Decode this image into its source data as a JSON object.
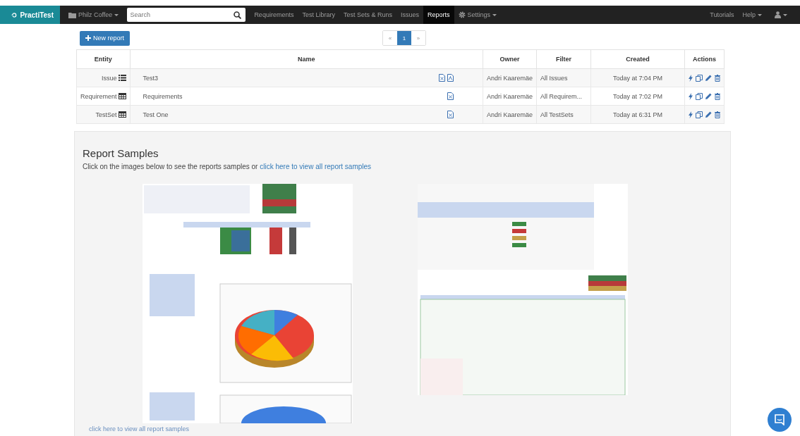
{
  "navbar": {
    "brand": "PractiTest",
    "project": "Philz Coffee",
    "search": {
      "placeholder": "Search"
    },
    "links": [
      {
        "label": "Requirements",
        "selected": false
      },
      {
        "label": "Test Library",
        "selected": false
      },
      {
        "label": "Test Sets & Runs",
        "selected": false
      },
      {
        "label": "Issues",
        "selected": false
      },
      {
        "label": "Reports",
        "selected": true
      }
    ],
    "settings": "Settings",
    "right_links": [
      {
        "label": "Tutorials",
        "dropdown": false
      },
      {
        "label": "Help",
        "dropdown": true
      }
    ]
  },
  "new_report_button": "New report",
  "pagination": {
    "prev": "«",
    "pages": [
      {
        "label": "1",
        "selected": true
      }
    ],
    "next": "»"
  },
  "table": {
    "columns": [
      "Entity",
      "Name",
      "Owner",
      "Filter",
      "Created",
      "Actions"
    ],
    "rows": [
      {
        "entity": "Issue",
        "kind": "list",
        "name": "Test3",
        "exports": [
          {
            "kind": "excel"
          },
          {
            "kind": "pdf"
          }
        ],
        "owner": "Andri Kaaremäe",
        "filter": "All Issues",
        "created": "Today at 7:04 PM"
      },
      {
        "entity": "Requirement",
        "kind": "grid",
        "name": "Requirements",
        "exports": [
          {
            "kind": "excel"
          }
        ],
        "owner": "Andri Kaaremäe",
        "filter": "All Requirem...",
        "created": "Today at 7:02 PM"
      },
      {
        "entity": "TestSet",
        "kind": "grid",
        "name": "Test One",
        "exports": [
          {
            "kind": "excel"
          }
        ],
        "owner": "Andri Kaaremäe",
        "filter": "All TestSets",
        "created": "Today at 6:31 PM"
      }
    ]
  },
  "samples": {
    "title": "Report Samples",
    "intro": "Click on the images below to see the reports samples or ",
    "intro_link": "click here to view all report samples",
    "footer_link": "click here to view all report samples"
  }
}
